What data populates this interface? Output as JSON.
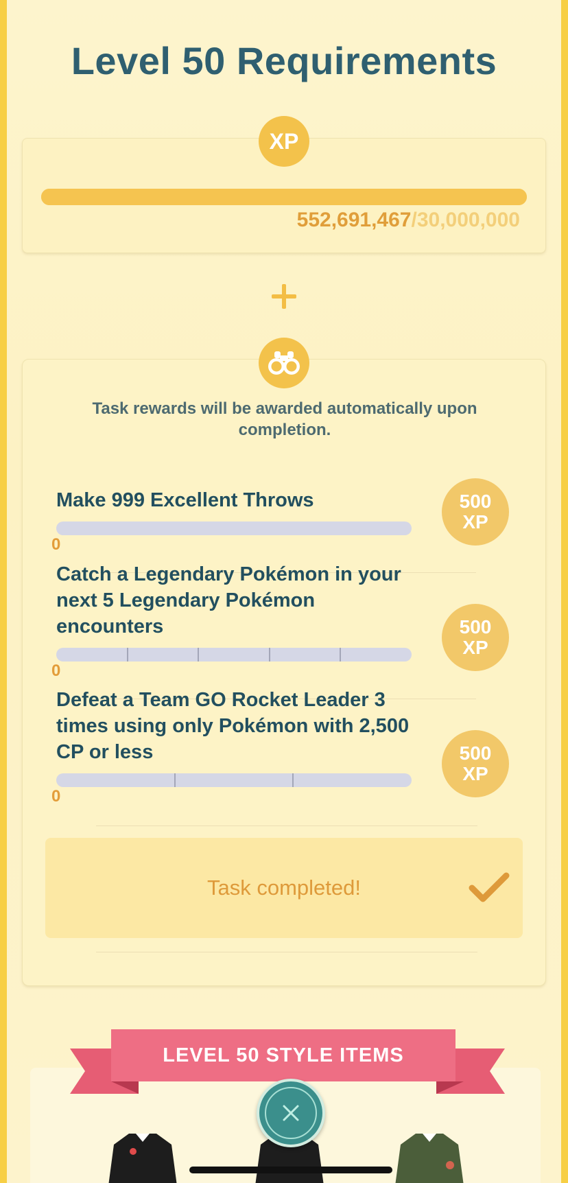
{
  "title": "Level 50 Requirements",
  "xp": {
    "badge": "XP",
    "current": "552,691,467",
    "separator": "/",
    "goal": "30,000,000",
    "progress": 1.0
  },
  "tasks_section": {
    "notice": "Task rewards will be awarded automatically upon completion.",
    "tasks": [
      {
        "title": "Make 999 Excellent Throws",
        "count": "0",
        "reward_amount": "500",
        "reward_unit": "XP",
        "segments": 1
      },
      {
        "title": "Catch a Legendary Pokémon in your next 5 Legendary Pokémon encounters",
        "count": "0",
        "reward_amount": "500",
        "reward_unit": "XP",
        "segments": 5
      },
      {
        "title": "Defeat a Team GO Rocket Leader 3 times using only Pokémon with 2,500 CP or less",
        "count": "0",
        "reward_amount": "500",
        "reward_unit": "XP",
        "segments": 3
      }
    ],
    "completed_label": "Task completed!"
  },
  "style_items": {
    "ribbon_label": "LEVEL 50 STYLE ITEMS"
  },
  "icons": {
    "binoculars": "binoculars-icon",
    "check": "checkmark-icon",
    "close": "close-icon",
    "plus": "plus-icon"
  },
  "colors": {
    "title": "#2f5f70",
    "accent": "#f3c24b",
    "ribbon": "#ee6e84",
    "close_button": "#3b8f8c"
  }
}
